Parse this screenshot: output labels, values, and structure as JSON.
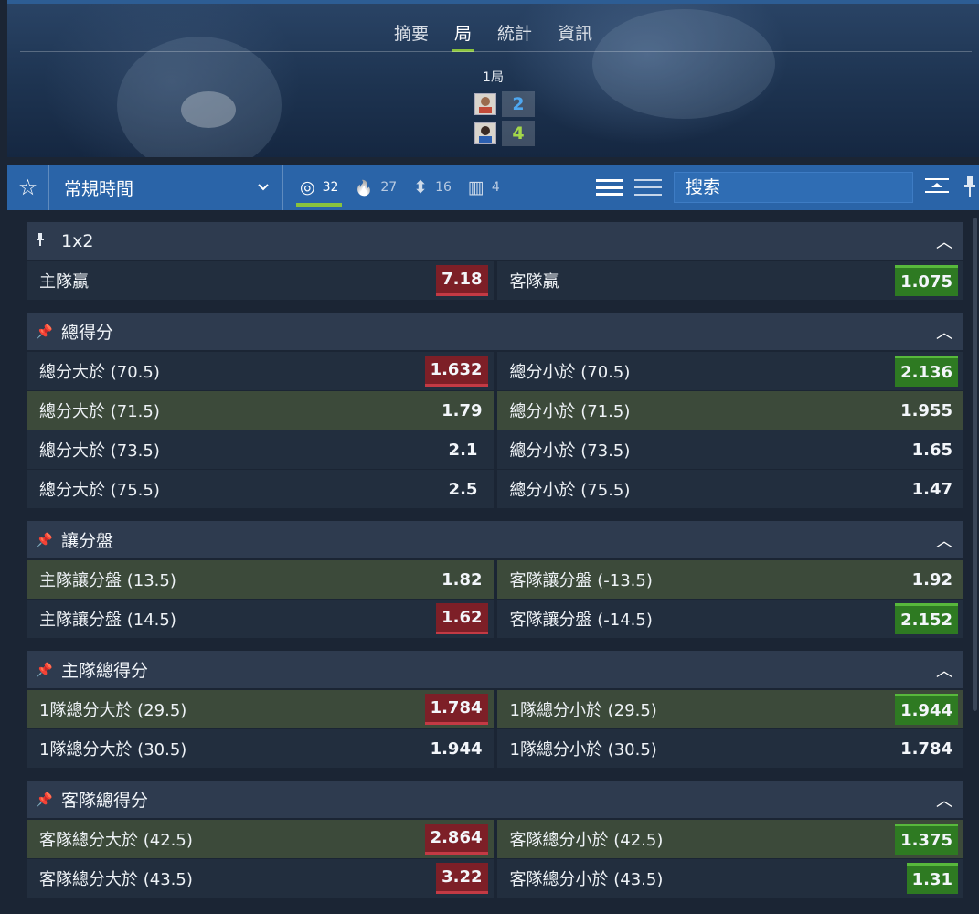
{
  "header": {
    "tabs": [
      {
        "label": "摘要",
        "active": false
      },
      {
        "label": "局",
        "active": true
      },
      {
        "label": "統計",
        "active": false
      },
      {
        "label": "資訊",
        "active": false
      }
    ],
    "period_label": "1局",
    "home_score": "2",
    "away_score": "4"
  },
  "toolbar": {
    "market_period": "常規時間",
    "filters": [
      {
        "icon": "target-icon",
        "glyph": "◎",
        "count": "32",
        "active": true
      },
      {
        "icon": "flame-icon",
        "glyph": "🔥",
        "count": "27",
        "active": false
      },
      {
        "icon": "updown-icon",
        "glyph": "⬍",
        "count": "16",
        "active": false
      },
      {
        "icon": "bars-icon",
        "glyph": "▥",
        "count": "4",
        "active": false
      }
    ],
    "search_placeholder": "搜索"
  },
  "colors": {
    "accent_green": "#8ac33c",
    "toolbar_blue": "#2a64a8",
    "odds_down": "#7d1f27",
    "odds_up": "#2e7a22"
  },
  "markets": [
    {
      "title": "1x2",
      "pinned_style": "pin",
      "rows": [
        [
          {
            "label": "主隊贏",
            "odds": "7.18",
            "state": "down",
            "hl": false
          },
          {
            "label": "客隊贏",
            "odds": "1.075",
            "state": "up",
            "hl": false
          }
        ]
      ]
    },
    {
      "title": "總得分",
      "pinned_style": "pushpin",
      "rows": [
        [
          {
            "label": "總分大於 (70.5)",
            "odds": "1.632",
            "state": "down",
            "hl": false
          },
          {
            "label": "總分小於 (70.5)",
            "odds": "2.136",
            "state": "up",
            "hl": false
          }
        ],
        [
          {
            "label": "總分大於 (71.5)",
            "odds": "1.79",
            "state": "",
            "hl": true
          },
          {
            "label": "總分小於 (71.5)",
            "odds": "1.955",
            "state": "",
            "hl": true
          }
        ],
        [
          {
            "label": "總分大於 (73.5)",
            "odds": "2.1",
            "state": "",
            "hl": false
          },
          {
            "label": "總分小於 (73.5)",
            "odds": "1.65",
            "state": "",
            "hl": false
          }
        ],
        [
          {
            "label": "總分大於 (75.5)",
            "odds": "2.5",
            "state": "",
            "hl": false
          },
          {
            "label": "總分小於 (75.5)",
            "odds": "1.47",
            "state": "",
            "hl": false
          }
        ]
      ]
    },
    {
      "title": "讓分盤",
      "pinned_style": "pushpin",
      "rows": [
        [
          {
            "label": "主隊讓分盤 (13.5)",
            "odds": "1.82",
            "state": "",
            "hl": true
          },
          {
            "label": "客隊讓分盤 (-13.5)",
            "odds": "1.92",
            "state": "",
            "hl": true
          }
        ],
        [
          {
            "label": "主隊讓分盤 (14.5)",
            "odds": "1.62",
            "state": "down",
            "hl": false
          },
          {
            "label": "客隊讓分盤 (-14.5)",
            "odds": "2.152",
            "state": "up",
            "hl": false
          }
        ]
      ]
    },
    {
      "title": "主隊總得分",
      "pinned_style": "pushpin",
      "rows": [
        [
          {
            "label": "1隊總分大於 (29.5)",
            "odds": "1.784",
            "state": "down",
            "hl": true
          },
          {
            "label": "1隊總分小於 (29.5)",
            "odds": "1.944",
            "state": "up",
            "hl": true
          }
        ],
        [
          {
            "label": "1隊總分大於 (30.5)",
            "odds": "1.944",
            "state": "",
            "hl": false
          },
          {
            "label": "1隊總分小於 (30.5)",
            "odds": "1.784",
            "state": "",
            "hl": false
          }
        ]
      ]
    },
    {
      "title": "客隊總得分",
      "pinned_style": "pushpin",
      "rows": [
        [
          {
            "label": "客隊總分大於 (42.5)",
            "odds": "2.864",
            "state": "down",
            "hl": true
          },
          {
            "label": "客隊總分小於 (42.5)",
            "odds": "1.375",
            "state": "up",
            "hl": true
          }
        ],
        [
          {
            "label": "客隊總分大於 (43.5)",
            "odds": "3.22",
            "state": "down",
            "hl": false
          },
          {
            "label": "客隊總分小於 (43.5)",
            "odds": "1.31",
            "state": "up",
            "hl": false
          }
        ]
      ]
    }
  ]
}
